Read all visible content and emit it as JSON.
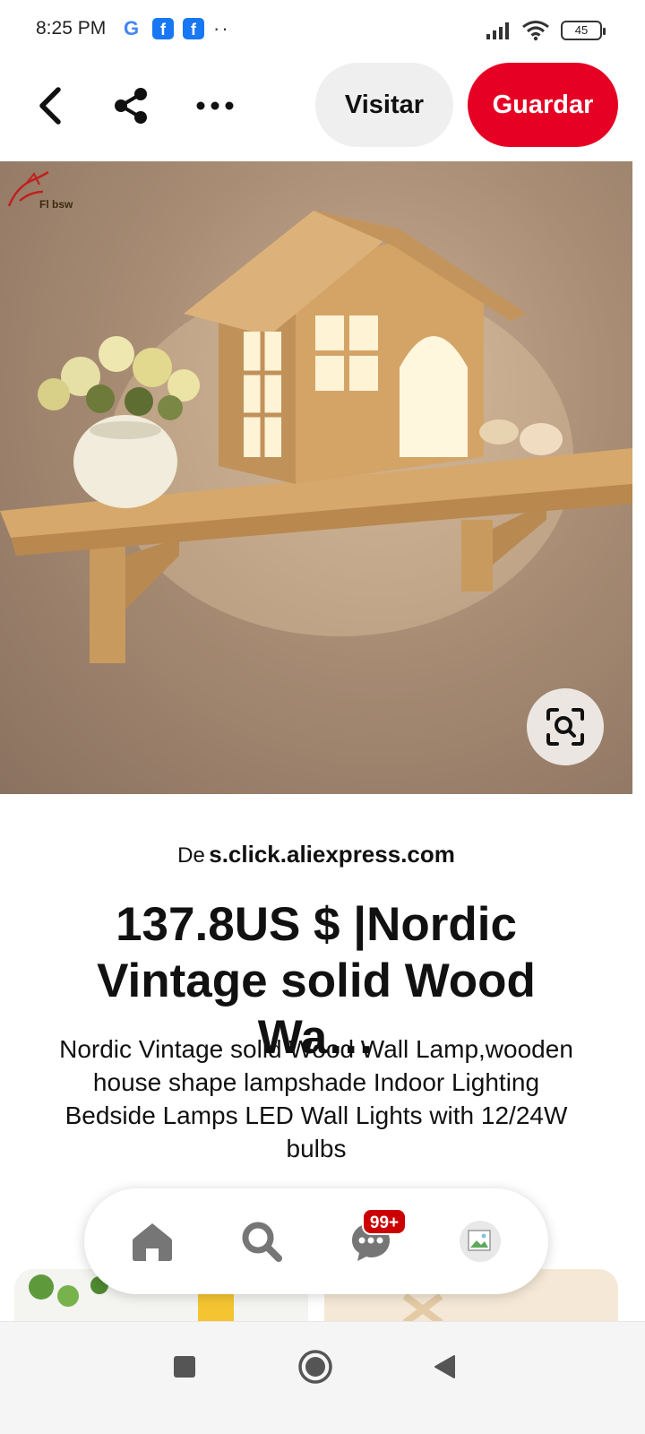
{
  "status_bar": {
    "time": "8:25 PM",
    "google_glyph": "G",
    "facebook_glyph": "f",
    "overflow_dots": "··",
    "battery": "45"
  },
  "top_bar": {
    "back_icon": "chevron-left-icon",
    "share_icon": "share-icon",
    "more_icon": "more-horizontal-icon",
    "visit_label": "Visitar",
    "save_label": "Guardar"
  },
  "pin": {
    "image_alt": "wooden house shaped wall lamp on shelf",
    "brand_mark_text": "Fl bsw",
    "lens_icon": "visual-search-icon",
    "source_prefix": "De",
    "source_domain": "s.click.aliexpress.com",
    "title": "137.8US $ |Nordic Vintage solid Wood Wa…",
    "description": "Nordic Vintage solid Wood Wall Lamp,wooden house shape lampshade Indoor Lighting Bedside Lamps LED Wall Lights with 12/24W bulbs"
  },
  "bottom_nav": {
    "items": [
      {
        "name": "home",
        "icon": "home-icon"
      },
      {
        "name": "search",
        "icon": "search-icon"
      },
      {
        "name": "messages",
        "icon": "chat-icon",
        "badge": "99+"
      },
      {
        "name": "profile",
        "icon": "avatar"
      }
    ]
  },
  "system_nav": {
    "recent_icon": "square-icon",
    "home_icon": "circle-icon",
    "back_icon": "triangle-back-icon"
  },
  "colors": {
    "brand_red": "#e60023",
    "visit_bg": "#efefef",
    "badge_red": "#cc0000"
  }
}
